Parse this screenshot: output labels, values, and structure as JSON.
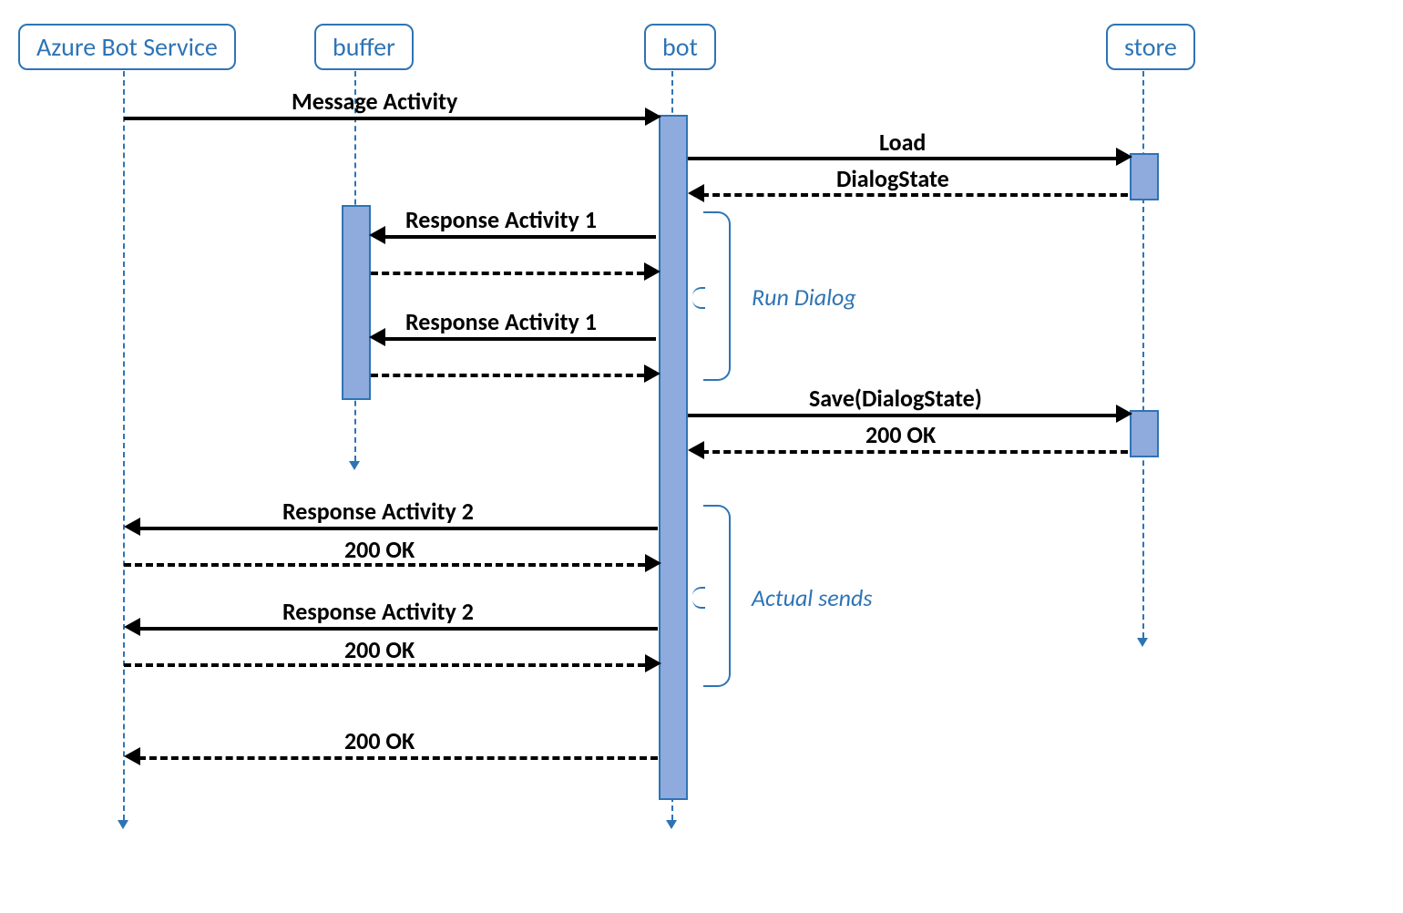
{
  "participants": {
    "abs": {
      "label": "Azure Bot Service"
    },
    "buffer": {
      "label": "buffer"
    },
    "bot": {
      "label": "bot"
    },
    "store": {
      "label": "store"
    }
  },
  "messages": {
    "m1": {
      "label": "Message Activity"
    },
    "m2": {
      "label": "Load"
    },
    "m3": {
      "label": "DialogState"
    },
    "m4": {
      "label": "Response Activity 1"
    },
    "m5": {
      "label": "Response Activity 1"
    },
    "m6": {
      "label": "Save(DialogState)"
    },
    "m7": {
      "label": "200 OK"
    },
    "m8": {
      "label": "Response Activity 2"
    },
    "m9": {
      "label": "200 OK"
    },
    "m10": {
      "label": "Response Activity 2"
    },
    "m11": {
      "label": "200 OK"
    },
    "m12": {
      "label": "200 OK"
    }
  },
  "annotations": {
    "runDialog": {
      "label": "Run Dialog"
    },
    "actualSends": {
      "label": "Actual sends"
    }
  }
}
